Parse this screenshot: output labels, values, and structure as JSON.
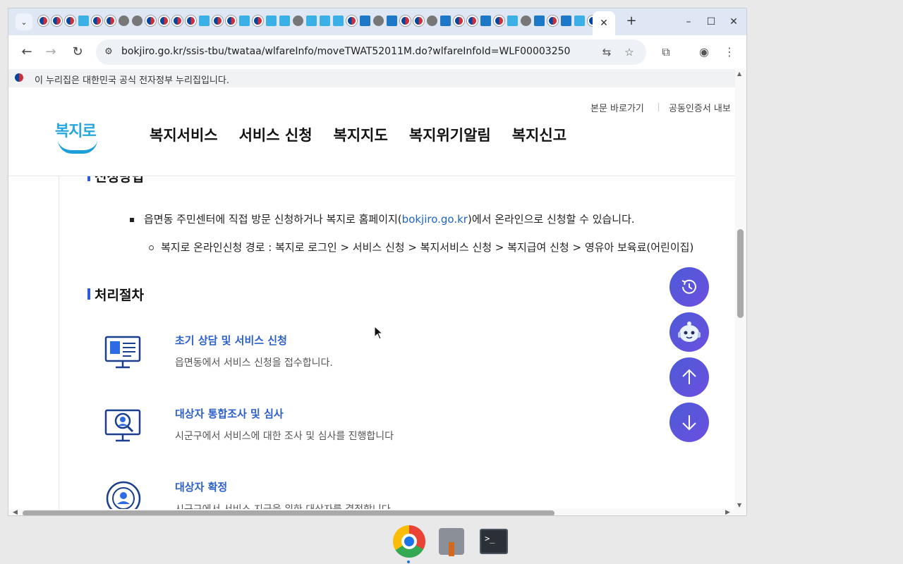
{
  "browser": {
    "active_tab_close": "✕",
    "new_tab": "+",
    "url": "bokjiro.go.kr/ssis-tbu/twataa/wlfareInfo/moveTWAT52011M.do?wlfareInfoId=WLF00003250",
    "window_controls": {
      "minimize": "–",
      "maximize": "☐",
      "close": "✕"
    }
  },
  "gov_banner": {
    "text": "이 누리집은 대한민국 공식 전자정부 누리집입니다."
  },
  "header": {
    "util_links": [
      "본문 바로가기",
      "공동인증서 내보"
    ],
    "logo_text": "복지로",
    "nav": [
      "복지서비스",
      "서비스 신청",
      "복지지도",
      "복지위기알림",
      "복지신고"
    ]
  },
  "content": {
    "section_cut_title": "신청방법",
    "apply_bullet_pre": "읍면동 주민센터에 직접 방문 신청하거나 복지로 홈페이지(",
    "apply_bullet_link": "bokjiro.go.kr",
    "apply_bullet_post": ")에서 온라인으로 신청할 수 있습니다.",
    "apply_sub": "복지로 온라인신청 경로 : 복지로 로그인 > 서비스 신청 > 복지서비스 신청 > 복지급여 신청 > 영유아 보육료(어린이집)",
    "process_title": "처리절차",
    "steps": [
      {
        "title": "초기 상담 및 서비스 신청",
        "desc": "읍면동에서 서비스 신청을 접수합니다."
      },
      {
        "title": "대상자 통합조사 및 심사",
        "desc": "시군구에서 서비스에 대한 조사 및 심사를 진행합니다"
      },
      {
        "title": "대상자 확정",
        "desc": "시군구에서 서비스 지급을 위한 대상자를 결정합니다"
      }
    ]
  },
  "fabs": [
    "recent-history",
    "chatbot",
    "scroll-top",
    "scroll-bottom"
  ],
  "colors": {
    "accent": "#2b5fc9",
    "fab": "#5a55dc",
    "logo": "#27a7de"
  }
}
